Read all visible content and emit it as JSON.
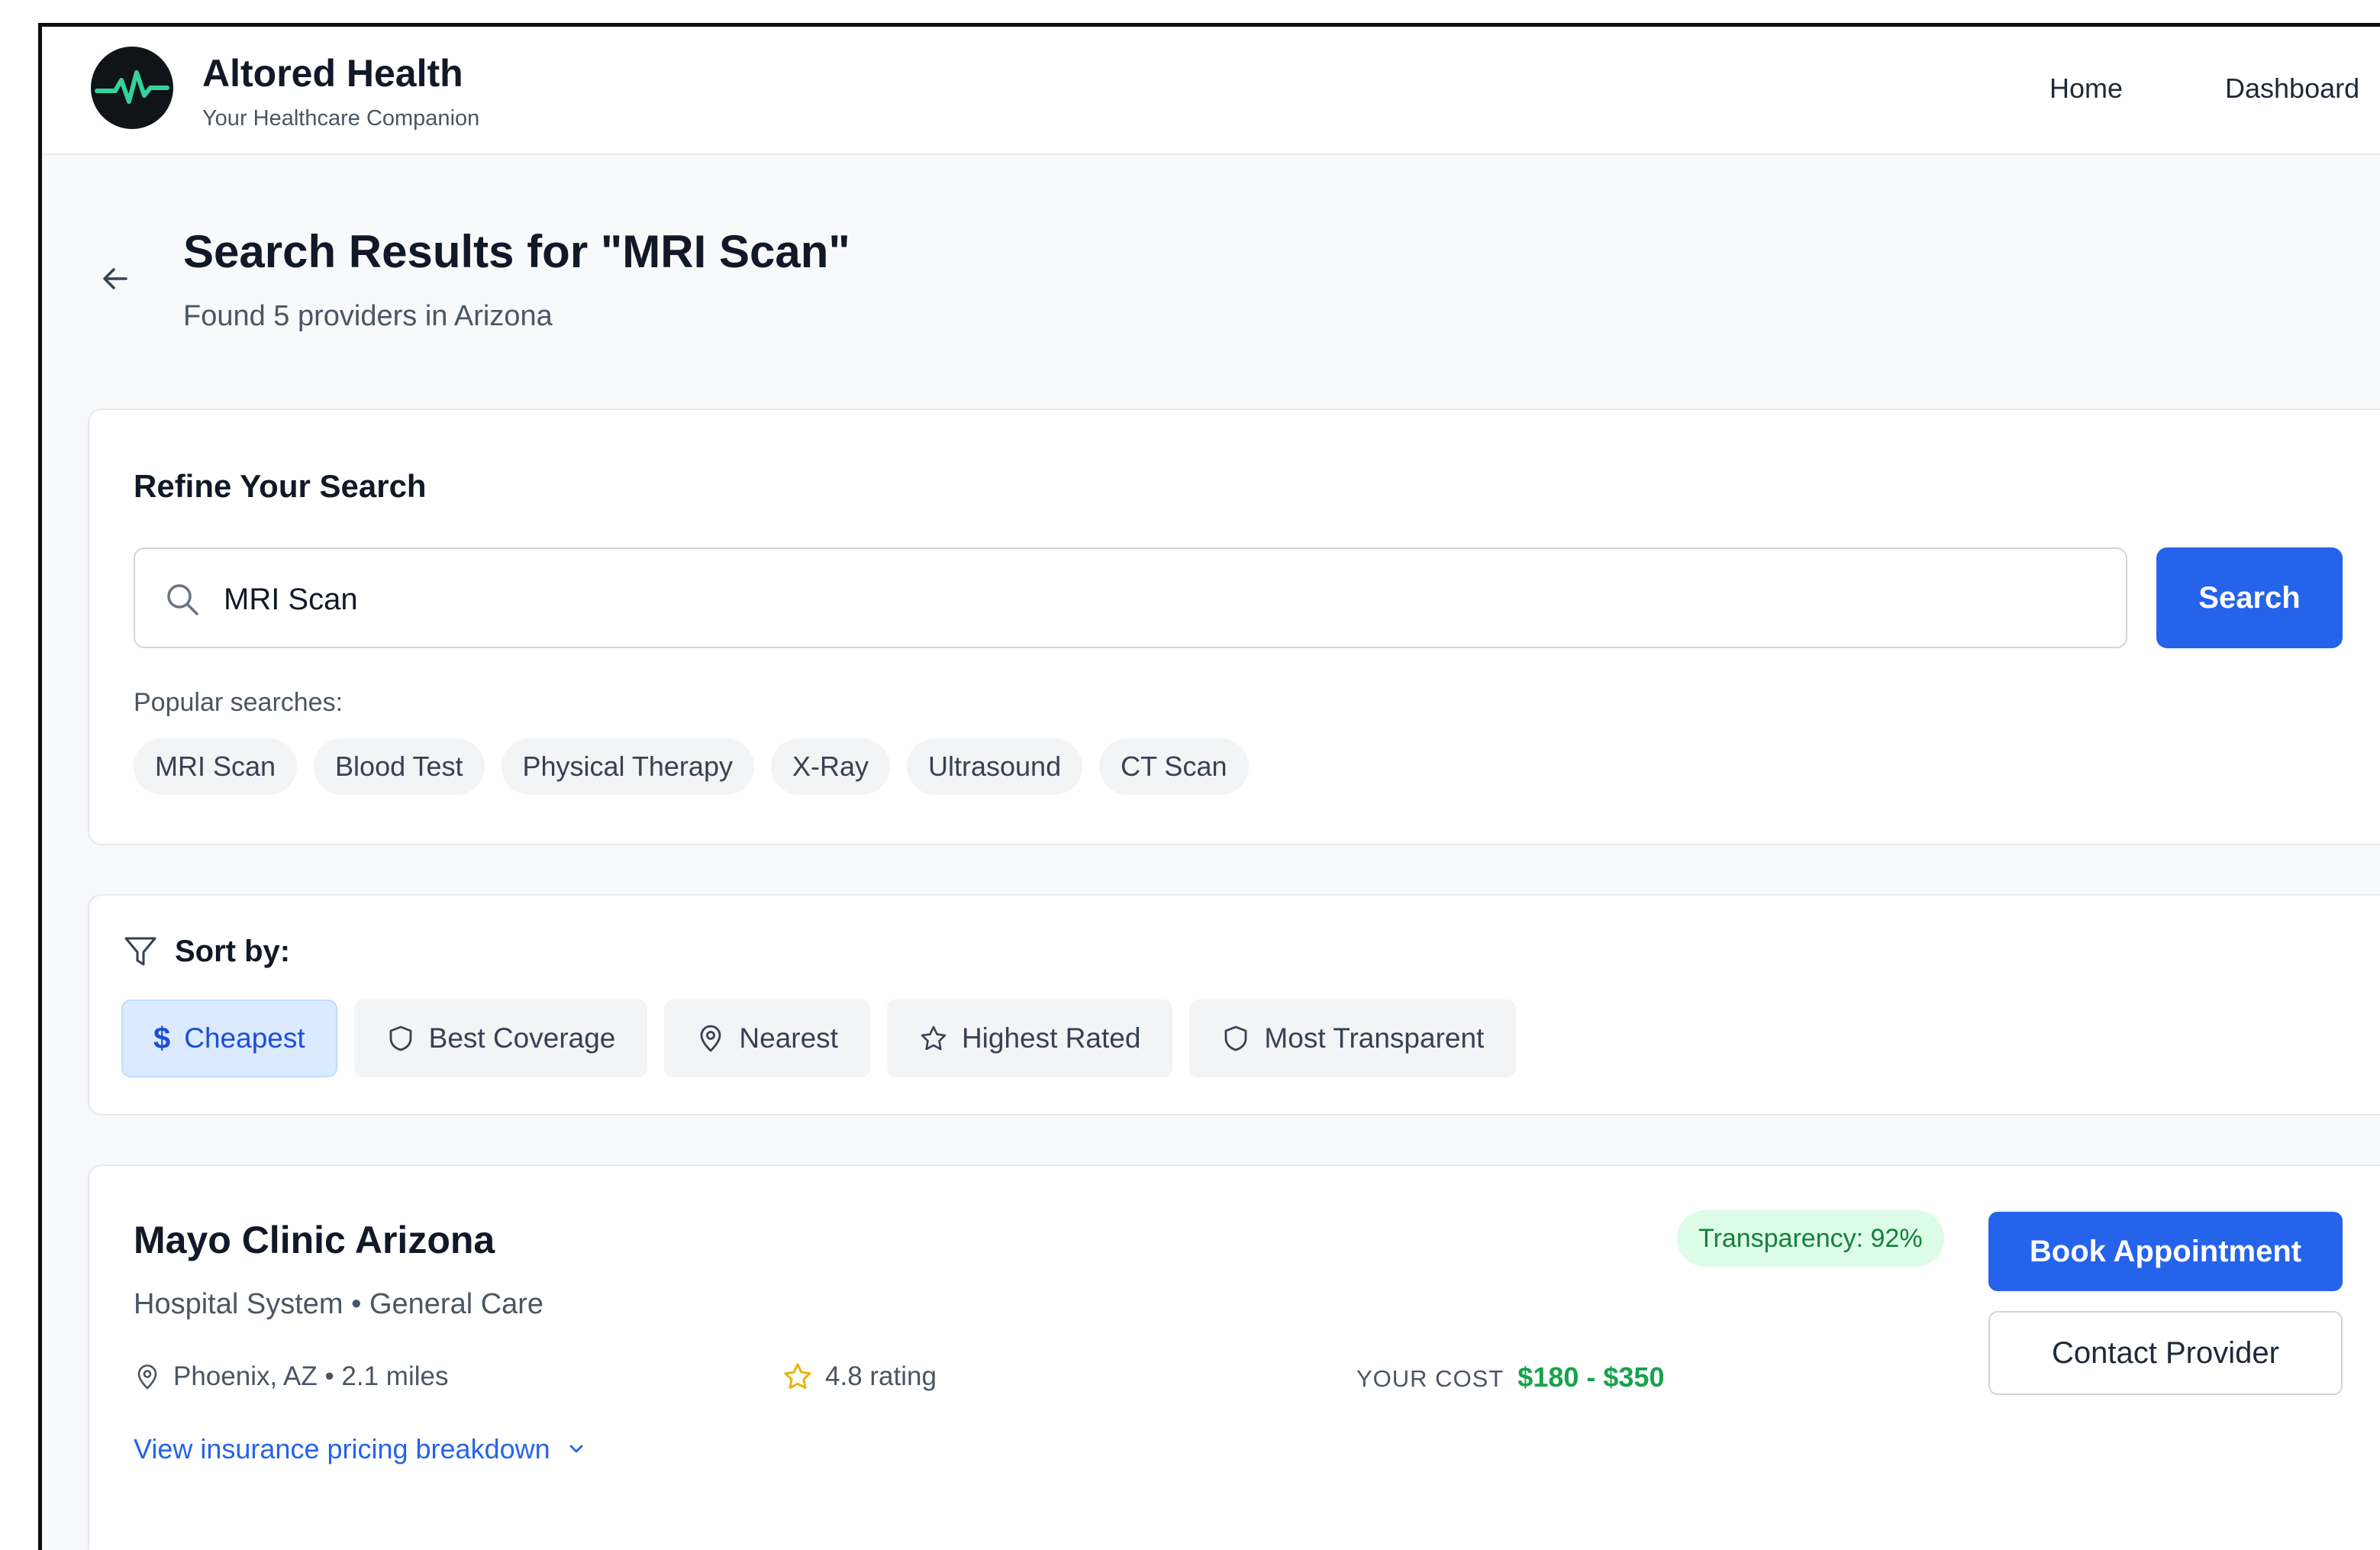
{
  "header": {
    "brand_name": "Altored Health",
    "tagline": "Your Healthcare Companion",
    "logo_icon": "heartbeat-pulse-icon",
    "nav": [
      {
        "label": "Home"
      },
      {
        "label": "Dashboard"
      }
    ]
  },
  "page": {
    "title": "Search Results for \"MRI Scan\"",
    "subtitle": "Found 5 providers in Arizona"
  },
  "search": {
    "section_title": "Refine Your Search",
    "query": "MRI Scan",
    "button_label": "Search",
    "popular_label": "Popular searches:",
    "popular": [
      "MRI Scan",
      "Blood Test",
      "Physical Therapy",
      "X-Ray",
      "Ultrasound",
      "CT Scan"
    ]
  },
  "sort": {
    "label": "Sort by:",
    "options": [
      {
        "label": "Cheapest",
        "icon": "dollar-icon",
        "active": true
      },
      {
        "label": "Best Coverage",
        "icon": "shield-icon",
        "active": false
      },
      {
        "label": "Nearest",
        "icon": "location-pin-icon",
        "active": false
      },
      {
        "label": "Highest Rated",
        "icon": "star-icon",
        "active": false
      },
      {
        "label": "Most Transparent",
        "icon": "shield-icon",
        "active": false
      }
    ]
  },
  "results": [
    {
      "name": "Mayo Clinic Arizona",
      "type": "Hospital System • General Care",
      "location": "Phoenix, AZ • 2.1 miles",
      "rating": "4.8 rating",
      "cost_label": "YOUR COST",
      "cost": "$180 - $350",
      "transparency": "Transparency: 92%",
      "breakdown_link": "View insurance pricing breakdown",
      "book_label": "Book Appointment",
      "contact_label": "Contact Provider"
    }
  ],
  "colors": {
    "primary": "#2563eb",
    "success": "#16a34a",
    "success_bg": "#dcfce7",
    "active_bg": "#dbeafe",
    "chip_bg": "#f3f4f6"
  }
}
